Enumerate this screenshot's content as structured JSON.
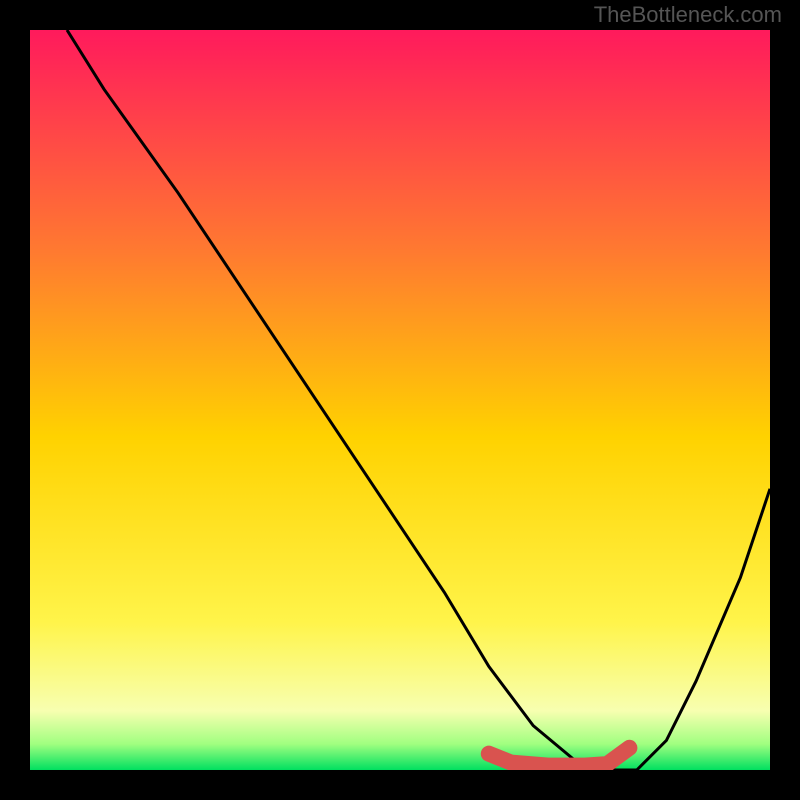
{
  "watermark": "TheBottleneck.com",
  "chart_data": {
    "type": "line",
    "title": "",
    "xlabel": "",
    "ylabel": "",
    "xlim": [
      0,
      100
    ],
    "ylim": [
      0,
      100
    ],
    "gradient_background": {
      "description": "vertical gradient red-orange-yellow-green, with thin green band at bottom",
      "stops": [
        {
          "pos": 0.0,
          "color": "#ff1a5c"
        },
        {
          "pos": 0.3,
          "color": "#ff7a30"
        },
        {
          "pos": 0.55,
          "color": "#ffd200"
        },
        {
          "pos": 0.8,
          "color": "#fff44a"
        },
        {
          "pos": 0.92,
          "color": "#f7ffb0"
        },
        {
          "pos": 0.965,
          "color": "#a0ff80"
        },
        {
          "pos": 1.0,
          "color": "#00e060"
        }
      ]
    },
    "series": [
      {
        "name": "bottleneck-curve",
        "description": "V-shaped black curve: left steep descent slightly convex, flat valley, right ascent",
        "x": [
          5,
          10,
          20,
          30,
          40,
          50,
          56,
          62,
          68,
          74,
          78,
          82,
          86,
          90,
          96,
          100
        ],
        "y": [
          100,
          92,
          78,
          63,
          48,
          33,
          24,
          14,
          6,
          1,
          0,
          0,
          4,
          12,
          26,
          38
        ]
      }
    ],
    "highlight_segment": {
      "description": "thick rounded red-pink segment along valley floor",
      "color": "#d9534f",
      "points_x": [
        62,
        65,
        70,
        75,
        78,
        81
      ],
      "points_y": [
        2.2,
        1.0,
        0.6,
        0.6,
        0.8,
        3.0
      ]
    }
  }
}
